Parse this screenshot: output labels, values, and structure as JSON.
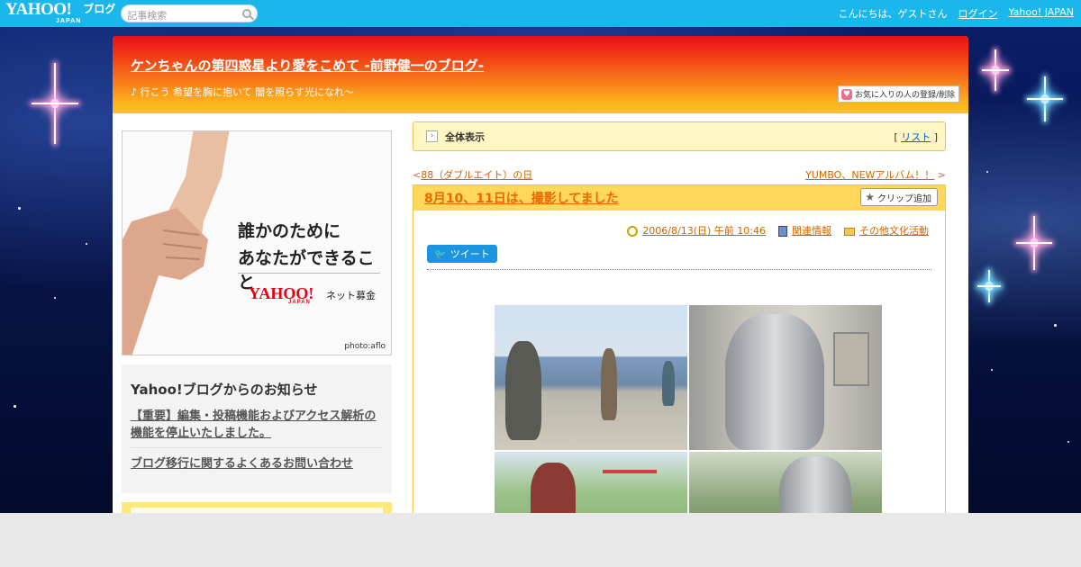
{
  "topbar": {
    "logo_text": "YAHOO!",
    "logo_sub": "JAPAN",
    "logo_blog": "ブログ",
    "search_placeholder": "記事検索",
    "greeting": "こんにちは、ゲストさん",
    "login": "ログイン",
    "yahoo_japan": "Yahoo! JAPAN"
  },
  "header": {
    "blog_title": "ケンちゃんの第四惑星より愛をこめて -前野健一のブログ-",
    "subtitle": "♪ 行こう 希望を胸に抱いて 闇を照らす光になれ～",
    "favorite_button": "お気に入りの人の登録/削除"
  },
  "ad": {
    "line1": "誰かのために",
    "line2": "あなたができること",
    "logo_text": "YAHOO!",
    "logo_sub": "JAPAN",
    "service": "ネット募金",
    "credit": "photo:aflo"
  },
  "notice": {
    "heading": "Yahoo!ブログからのお知らせ",
    "items": [
      "【重要】編集・投稿機能およびアクセス解析の機能を停止いたしました。",
      "ブログ移行に関するよくあるお問い合わせ"
    ]
  },
  "listbar": {
    "label": "全体表示",
    "list_open": "[ ",
    "list_link": "リスト",
    "list_close": " ]"
  },
  "pager": {
    "prev_mark": "<",
    "prev": "88（ダブルエイト）の日",
    "next": "YUMBO、NEWアルバム！！",
    "next_mark": ">"
  },
  "entry": {
    "title": "8月10、11日は、撮影してました",
    "clip_button": "クリップ追加",
    "date": "2006/8/13(日) 午前 10:46",
    "related": "関連情報",
    "category": "その他文化活動",
    "tweet": "ツイート"
  },
  "colors": {
    "topbar": "#1ab7ea",
    "header_top": "#e8101a",
    "header_bottom": "#fcc41f",
    "link_orange": "#cc6600",
    "entry_head": "#ffd75b"
  },
  "icons": [
    "search-icon",
    "heart-icon",
    "arrow-icon",
    "star-icon",
    "clock-icon",
    "book-icon",
    "folder-icon",
    "twitter-bird-icon"
  ]
}
